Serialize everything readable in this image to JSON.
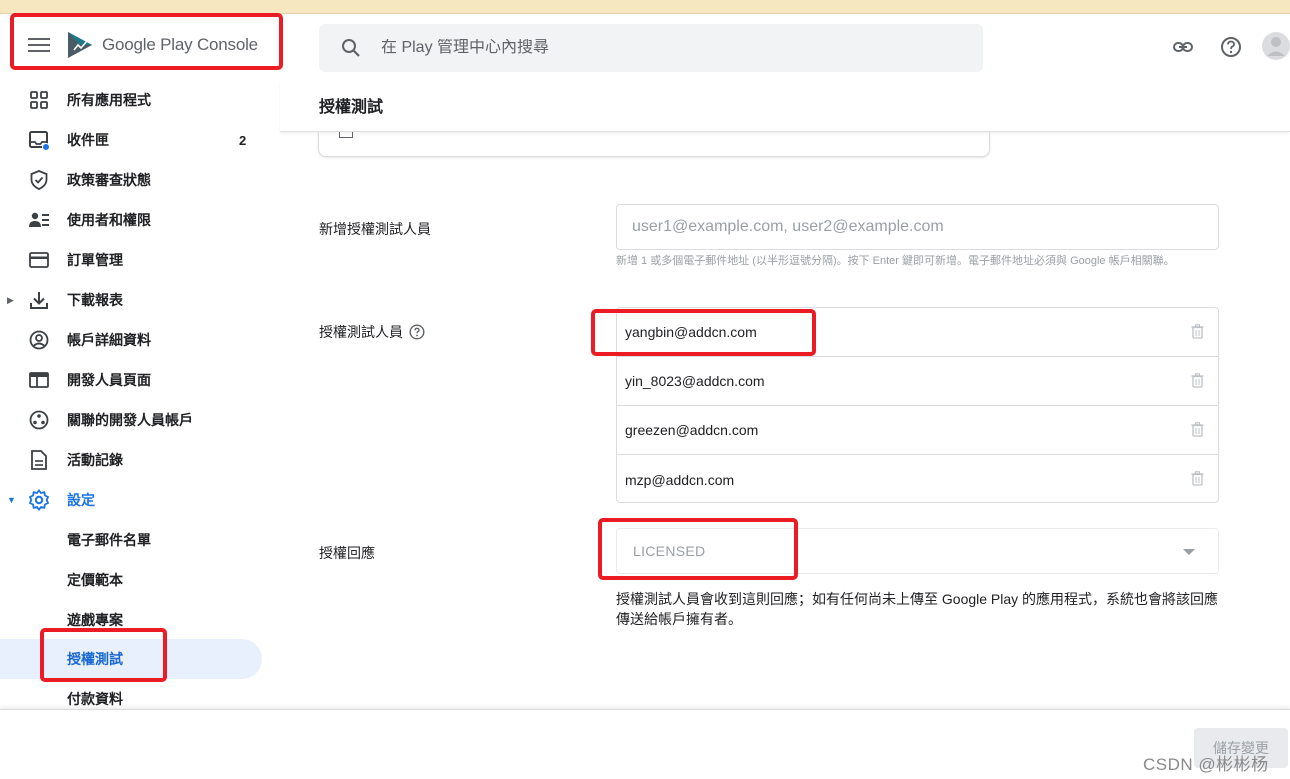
{
  "app": {
    "name_prefix": "Google Play",
    "name_suffix": "Console"
  },
  "search": {
    "placeholder": "在 Play 管理中心內搜尋"
  },
  "sidebar": {
    "items": [
      {
        "label": "所有應用程式",
        "icon": "grid-icon"
      },
      {
        "label": "收件匣",
        "icon": "inbox-icon",
        "count": "2"
      },
      {
        "label": "政策審查狀態",
        "icon": "shield-icon"
      },
      {
        "label": "使用者和權限",
        "icon": "users-icon"
      },
      {
        "label": "訂單管理",
        "icon": "credit-card-icon"
      },
      {
        "label": "下載報表",
        "icon": "download-icon"
      },
      {
        "label": "帳戶詳細資料",
        "icon": "account-circle-icon"
      },
      {
        "label": "開發人員頁面",
        "icon": "web-page-icon"
      },
      {
        "label": "關聯的開發人員帳戶",
        "icon": "linked-accounts-icon"
      },
      {
        "label": "活動記錄",
        "icon": "document-icon"
      },
      {
        "label": "設定",
        "icon": "gear-icon"
      }
    ],
    "sub_items": [
      {
        "label": "電子郵件名單"
      },
      {
        "label": "定價範本"
      },
      {
        "label": "遊戲專案"
      },
      {
        "label": "授權測試"
      },
      {
        "label": "付款資料"
      }
    ]
  },
  "page": {
    "title": "授權測試",
    "add_testers_label": "新增授權測試人員",
    "add_testers_placeholder": "user1@example.com, user2@example.com",
    "add_testers_helper": "新增 1 或多個電子郵件地址 (以半形逗號分隔)。按下 Enter 鍵即可新增。電子郵件地址必須與 Google 帳戶相關聯。",
    "testers_label": "授權測試人員",
    "testers": [
      "yangbin@addcn.com",
      "yin_8023@addcn.com",
      "greezen@addcn.com",
      "mzp@addcn.com"
    ],
    "response_label": "授權回應",
    "response_value": "LICENSED",
    "response_description": "授權測試人員會收到這則回應；如有任何尚未上傳至 Google Play 的應用程式，系統也會將該回應傳送給帳戶擁有者。"
  },
  "footer": {
    "save_label": "儲存變更",
    "watermark": "CSDN @彬彬杨"
  },
  "colors": {
    "accent": "#1a73e8",
    "highlight_box": "#ec1c24",
    "selected_bg": "#e8f0fe"
  }
}
